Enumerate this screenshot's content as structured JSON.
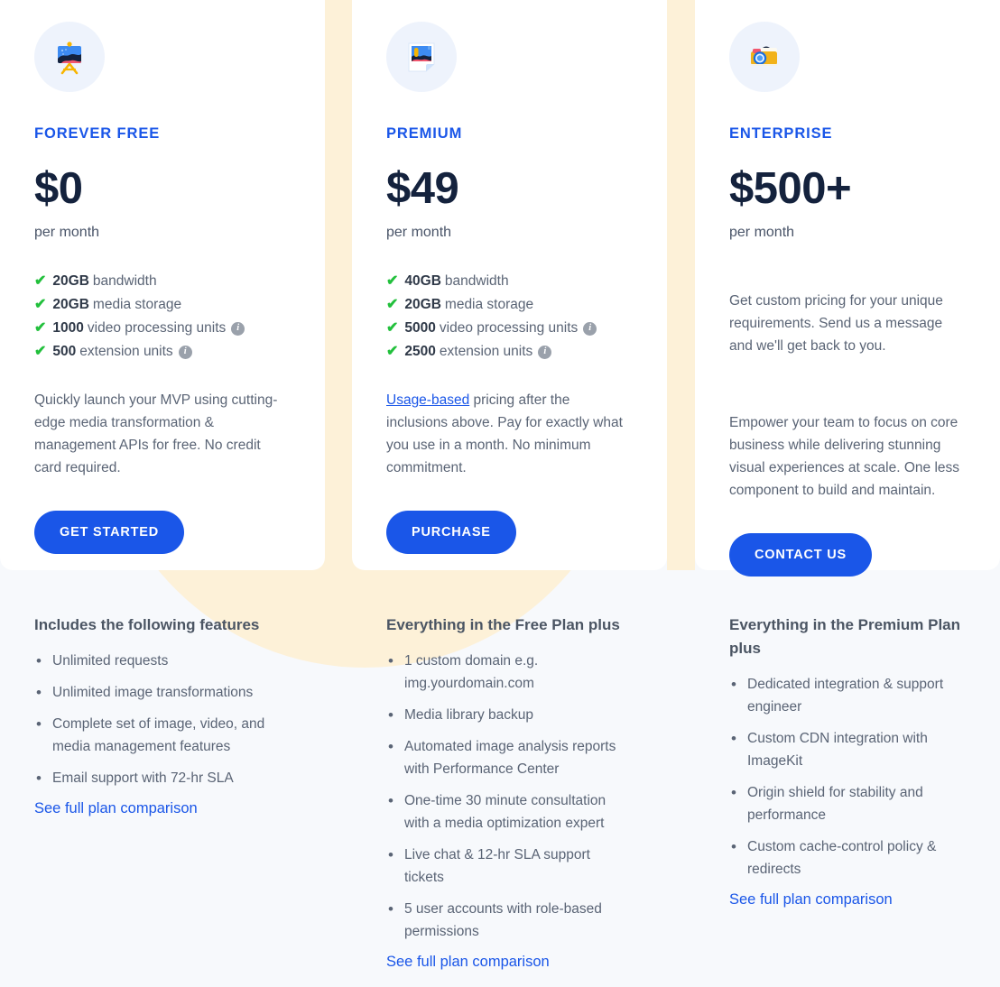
{
  "colors": {
    "accent_blue": "#1a56e8",
    "price_navy": "#14223d",
    "check_green": "#22c03c",
    "cream": "#fdf1d8",
    "page_bg": "#f7f9fc",
    "info_gray": "#9aa1ab"
  },
  "plans": [
    {
      "icon": "easel-icon",
      "name": "FOREVER FREE",
      "price": "$0",
      "period": "per month",
      "inclusions": [
        {
          "value": "20GB",
          "label": "bandwidth",
          "info": false
        },
        {
          "value": "20GB",
          "label": "media storage",
          "info": false
        },
        {
          "value": "1000",
          "label": "video processing units",
          "info": true
        },
        {
          "value": "500",
          "label": "extension units",
          "info": true
        }
      ],
      "blurb_prefix": "",
      "blurb_link": "",
      "blurb": "Quickly launch your MVP using cutting-edge media transformation & management APIs for free. No credit card required.",
      "cta": "GET STARTED",
      "features_title": "Includes the following features",
      "features": [
        "Unlimited requests",
        "Unlimited image transformations",
        "Complete set of image, video, and media management features",
        "Email support with 72-hr SLA"
      ],
      "comparison_link": "See full plan comparison"
    },
    {
      "icon": "photo-icon",
      "name": "PREMIUM",
      "price": "$49",
      "period": "per month",
      "inclusions": [
        {
          "value": "40GB",
          "label": "bandwidth",
          "info": false
        },
        {
          "value": "20GB",
          "label": "media storage",
          "info": false
        },
        {
          "value": "5000",
          "label": "video processing units",
          "info": true
        },
        {
          "value": "2500",
          "label": "extension units",
          "info": true
        }
      ],
      "blurb_link": "Usage-based",
      "blurb": " pricing after the inclusions above. Pay for exactly what you use in a month. No minimum commitment.",
      "cta": "PURCHASE",
      "features_title": "Everything in the Free Plan plus",
      "features": [
        "1 custom domain e.g. img.yourdomain.com",
        "Media library backup",
        "Automated image analysis reports with Performance Center",
        "One-time 30 minute consultation with a media optimization expert",
        "Live chat & 12-hr SLA support tickets",
        "5 user accounts with role-based permissions"
      ],
      "comparison_link": "See full plan comparison"
    },
    {
      "icon": "camera-icon",
      "name": "ENTERPRISE",
      "price": "$500+",
      "period": "per month",
      "inclusions": [],
      "blurb_top": "Get custom pricing for your unique requirements. Send us a message and we'll get back to you.",
      "blurb": "Empower your team to focus on core business while delivering stunning visual experiences at scale. One less component to build and maintain.",
      "cta": "CONTACT US",
      "features_title": "Everything in the Premium Plan plus",
      "features": [
        "Dedicated integration & support engineer",
        "Custom CDN integration with ImageKit",
        "Origin shield for stability and performance",
        "Custom cache-control policy & redirects"
      ],
      "comparison_link": "See full plan comparison"
    }
  ]
}
